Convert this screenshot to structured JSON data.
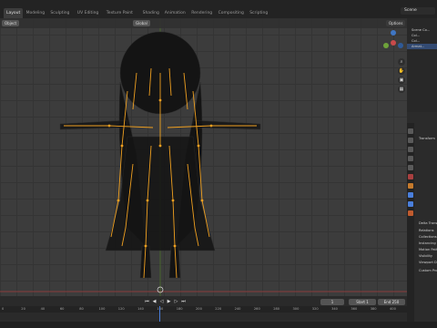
{
  "workspace_tabs": [
    {
      "label": "Layout",
      "active": true
    },
    {
      "label": "Modeling",
      "active": false
    },
    {
      "label": "Sculpting",
      "active": false
    },
    {
      "label": "UV Editing",
      "active": false
    },
    {
      "label": "Texture Paint",
      "active": false
    },
    {
      "label": "Shading",
      "active": false
    },
    {
      "label": "Animation",
      "active": false
    },
    {
      "label": "Rendering",
      "active": false
    },
    {
      "label": "Compositing",
      "active": false
    },
    {
      "label": "Scripting",
      "active": false
    }
  ],
  "scene": {
    "name": "Scene"
  },
  "viewport": {
    "mode_label": "Object",
    "transform_orientation": "Global",
    "options_label": "Options",
    "axes": [
      "X",
      "Y",
      "Z"
    ]
  },
  "outliner": {
    "rows": [
      "Scene Co...",
      "Col...",
      "Col...",
      "Armat..."
    ]
  },
  "properties": {
    "sections": [
      "Transform",
      "Delta Transform",
      "Relations",
      "Collections",
      "Instancing",
      "Motion Paths",
      "Visibility",
      "Viewport Display",
      "Custom Properties"
    ],
    "colors": {
      "active_tab": "#4a7fdc",
      "armature_icon": "#c05b2e"
    }
  },
  "timeline": {
    "current_frame": "1",
    "start_label": "Start",
    "start_value": "1",
    "end_label": "End",
    "end_value": "250",
    "ruler_ticks": [
      "0",
      "20",
      "40",
      "60",
      "80",
      "100",
      "120",
      "140",
      "160",
      "180",
      "200",
      "220",
      "240",
      "260",
      "280",
      "300",
      "320",
      "340",
      "360",
      "380",
      "400"
    ]
  },
  "colors": {
    "bone_orange": "#f0a020",
    "mesh_dark": "#151515",
    "viewport_bg": "#3c3c3c",
    "playhead": "#4a7fdc"
  }
}
